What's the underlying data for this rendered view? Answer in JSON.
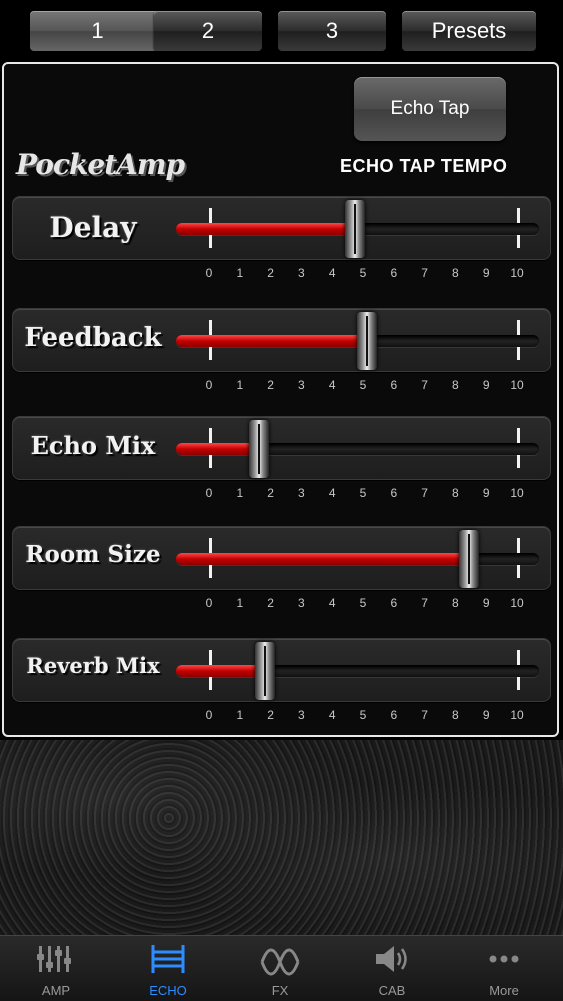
{
  "top_tabs": [
    "1",
    "2",
    "3",
    "Presets"
  ],
  "echo_tap_button": "Echo Tap",
  "logo_text": "PocketAmp",
  "echo_tap_tempo": "ECHO TAP TEMPO",
  "scale_labels": [
    "0",
    "1",
    "2",
    "3",
    "4",
    "5",
    "6",
    "7",
    "8",
    "9",
    "10"
  ],
  "sliders": [
    {
      "label": "Delay",
      "value": 4.7
    },
    {
      "label": "Feedback",
      "value": 5.1
    },
    {
      "label": "Echo Mix",
      "value": 1.6
    },
    {
      "label": "Room Size",
      "value": 8.4
    },
    {
      "label": "Reverb Mix",
      "value": 1.8
    }
  ],
  "tabs": [
    {
      "label": "AMP",
      "icon": "amp-mixer-icon",
      "active": false
    },
    {
      "label": "ECHO",
      "icon": "echo-icon",
      "active": true
    },
    {
      "label": "FX",
      "icon": "fx-wave-icon",
      "active": false
    },
    {
      "label": "CAB",
      "icon": "speaker-icon",
      "active": false
    },
    {
      "label": "More",
      "icon": "more-dots-icon",
      "active": false
    }
  ],
  "colors": {
    "accent": "#2d8cff",
    "fill_red": "#c40000",
    "tab_inactive": "#999999"
  }
}
